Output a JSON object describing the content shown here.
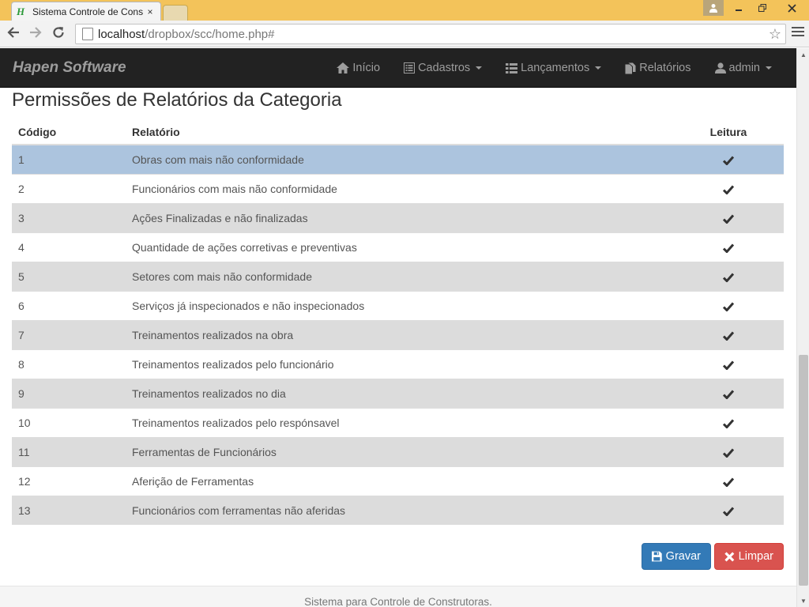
{
  "browser": {
    "tab_title": "Sistema Controle de Cons",
    "tab_close": "×",
    "favicon": "H",
    "url_host": "localhost",
    "url_path": "/dropbox/scc/home.php#",
    "icons": {
      "back": "arrow-left-icon",
      "forward": "arrow-right-icon",
      "reload": "reload-icon",
      "bookmark": "star-icon",
      "menu": "hamburger-menu-icon"
    }
  },
  "navbar": {
    "brand": "Hapen Software",
    "items": [
      {
        "label": "Início",
        "icon": "home-icon",
        "dropdown": false
      },
      {
        "label": "Cadastros",
        "icon": "list-alt-icon",
        "dropdown": true
      },
      {
        "label": "Lançamentos",
        "icon": "list-icon",
        "dropdown": true
      },
      {
        "label": "Relatórios",
        "icon": "duplicate-icon",
        "dropdown": false
      },
      {
        "label": "admin",
        "icon": "user-icon",
        "dropdown": true
      }
    ]
  },
  "page": {
    "title": "Permissões de Relatórios da Categoria"
  },
  "table": {
    "headers": {
      "code": "Código",
      "report": "Relatório",
      "read": "Leitura"
    },
    "rows": [
      {
        "code": "1",
        "report": "Obras com mais não conformidade",
        "read": true
      },
      {
        "code": "2",
        "report": "Funcionários com mais não conformidade",
        "read": true
      },
      {
        "code": "3",
        "report": "Ações Finalizadas e não finalizadas",
        "read": true
      },
      {
        "code": "4",
        "report": "Quantidade de ações corretivas e preventivas",
        "read": true
      },
      {
        "code": "5",
        "report": "Setores com mais não conformidade",
        "read": true
      },
      {
        "code": "6",
        "report": "Serviços já inspecionados e não inspecionados",
        "read": true
      },
      {
        "code": "7",
        "report": "Treinamentos realizados na obra",
        "read": true
      },
      {
        "code": "8",
        "report": "Treinamentos realizados pelo funcionário",
        "read": true
      },
      {
        "code": "9",
        "report": "Treinamentos realizados no dia",
        "read": true
      },
      {
        "code": "10",
        "report": "Treinamentos realizados pelo respónsavel",
        "read": true
      },
      {
        "code": "11",
        "report": "Ferramentas de Funcionários",
        "read": true
      },
      {
        "code": "12",
        "report": "Aferição de Ferramentas",
        "read": true
      },
      {
        "code": "13",
        "report": "Funcionários com ferramentas não aferidas",
        "read": true
      }
    ],
    "selected_row": 0
  },
  "actions": {
    "save_label": "Gravar",
    "clear_label": "Limpar"
  },
  "footer": {
    "text": "Sistema para Controle de Construtoras."
  },
  "colors": {
    "navbar_bg": "#222222",
    "selected_row": "#acc4de",
    "striped_row": "#dcdcdc",
    "save_button": "#337ab7",
    "clear_button": "#d9534f"
  }
}
